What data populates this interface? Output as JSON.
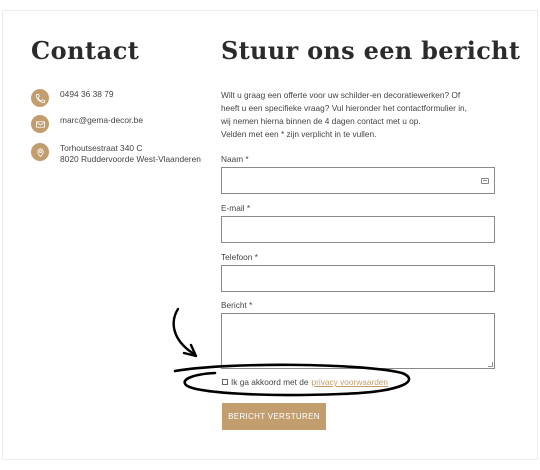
{
  "contact": {
    "title": "Contact",
    "items": [
      {
        "icon": "phone-icon",
        "lines": [
          "0494 36 38 79"
        ]
      },
      {
        "icon": "mail-icon",
        "lines": [
          "marc@gema-decor.be"
        ]
      },
      {
        "icon": "location-pin-icon",
        "lines": [
          "Torhoutsestraat 340 C",
          "8020 Ruddervoorde West-Vlaanderen"
        ]
      }
    ]
  },
  "form": {
    "title": "Stuur ons een bericht",
    "intro_lines": [
      "Wilt u graag een offerte voor uw schilder-en decoratiewerken? Of",
      "heeft u een specifieke vraag? Vul hieronder het contactformulier in,",
      "wij nemen hierna binnen de 4 dagen contact met u op.",
      "Velden met een * zijn verplicht in te vullen."
    ],
    "fields": {
      "name_label": "Naam *",
      "email_label": "E-mail *",
      "phone_label": "Telefoon *",
      "message_label": "Bericht *"
    },
    "consent_text": "Ik ga akkoord met de",
    "consent_link": "privacy voorwaarden",
    "submit_label": "BERICHT VERSTUREN"
  },
  "colors": {
    "accent": "#c29d6e",
    "heading": "#2b2b2b",
    "text": "#444444",
    "annotation": "#000000"
  }
}
